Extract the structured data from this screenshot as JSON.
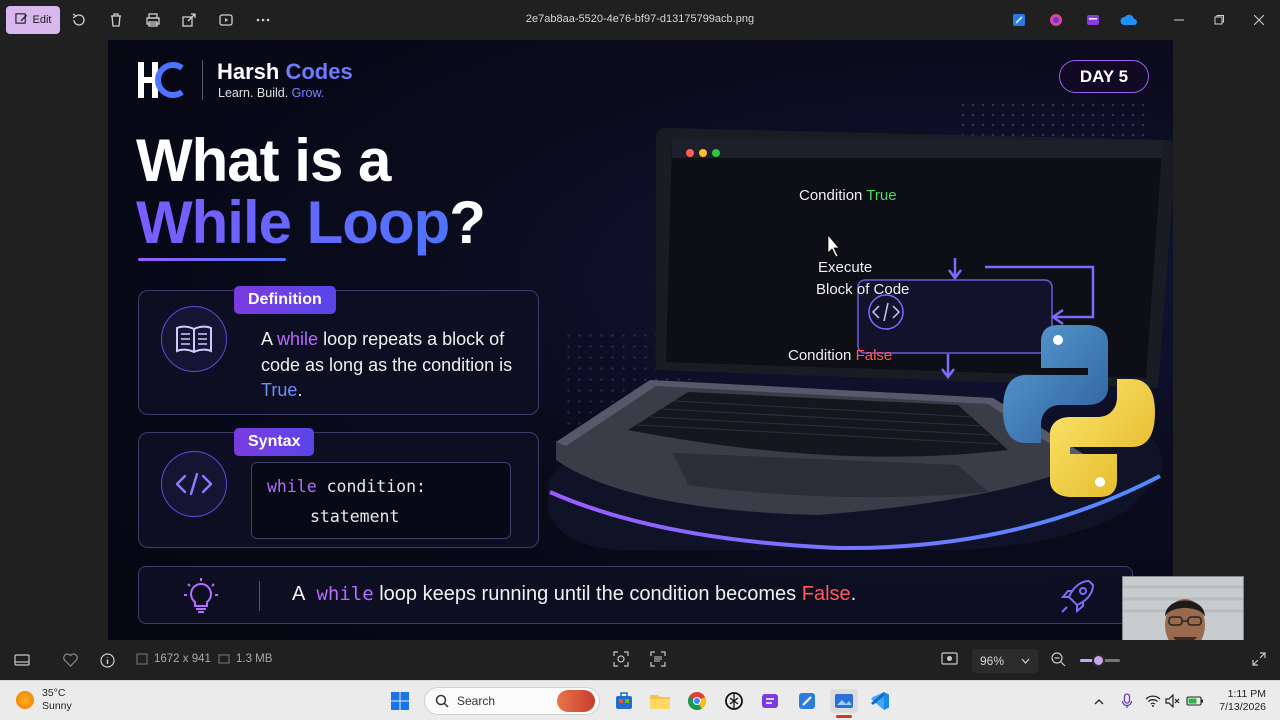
{
  "titlebar": {
    "edit_label": "Edit",
    "file_name": "2e7ab8aa-5520-4e76-bf97-d13175799acb.png"
  },
  "slide": {
    "logo_text": "HC",
    "brand_name": "Harsh",
    "brand_accent": "Codes",
    "tagline_a": "Learn. Build.",
    "tagline_b": "Grow.",
    "day_badge": "DAY 5",
    "headline_line1": "What is a",
    "headline_highlight": "While Loop",
    "headline_q": "?",
    "definition": {
      "label": "Definition",
      "text_a": "A",
      "keyword": "while",
      "text_b": "loop repeats a block of code as long as the condition is",
      "value": "True",
      "text_c": "."
    },
    "syntax": {
      "label": "Syntax",
      "keyword": "while",
      "line1_rest": " condition:",
      "line2": "statement"
    },
    "flow": {
      "top_a": "Condition",
      "top_b": "True",
      "box_line1": "Execute",
      "box_line2": "Block of Code",
      "bottom_a": "Condition",
      "bottom_b": "False"
    },
    "banner": {
      "text_a": "A",
      "keyword": "while",
      "text_b": "loop  keeps running until the condition becomes",
      "value": "False",
      "text_c": "."
    },
    "colors": {
      "accent_purple": "#b56cff",
      "accent_blue": "#6f8dff",
      "false_red": "#ff5b5b",
      "true_green": "#4cd964"
    }
  },
  "statusbar": {
    "dimensions": "1672 x 941",
    "file_size": "1.3 MB",
    "zoom": "96%"
  },
  "taskbar": {
    "temperature": "35°C",
    "condition": "Sunny",
    "search_placeholder": "Search",
    "time": "1:11 PM",
    "date": "7/13/2026"
  },
  "icons": [
    "edit-icon",
    "rotate-icon",
    "delete-icon",
    "print-icon",
    "share-icon",
    "slideshow-icon",
    "more-icon",
    "minimize-icon",
    "maximize-icon",
    "close-icon",
    "book-icon",
    "code-icon",
    "lightbulb-icon",
    "rocket-icon",
    "python-logo-icon",
    "filmstrip-icon",
    "heart-icon",
    "info-icon",
    "face-detect-icon",
    "scan-icon",
    "zoom-out-icon",
    "fullscreen-icon",
    "windows-start-icon",
    "search-icon",
    "chrome-icon",
    "vscode-icon"
  ]
}
